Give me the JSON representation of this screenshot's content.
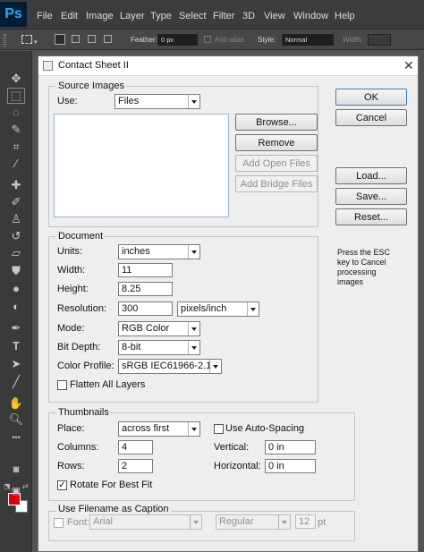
{
  "app": {
    "logo": "Ps"
  },
  "menubar": {
    "items": [
      "File",
      "Edit",
      "Image",
      "Layer",
      "Type",
      "Select",
      "Filter",
      "3D",
      "View",
      "Window",
      "Help"
    ]
  },
  "options_bar": {
    "feather_label": "Feather:",
    "feather_value": "0 px",
    "antialias_label": "Anti-alias",
    "style_label": "Style:",
    "style_value": "Normal",
    "width_label": "Width:"
  },
  "toolbar": {
    "tools": [
      "move-tool",
      "marquee-tool",
      "lasso-tool",
      "quick-select-tool",
      "crop-tool",
      "eyedropper-tool",
      "healing-brush-tool",
      "brush-tool",
      "clone-stamp-tool",
      "history-brush-tool",
      "eraser-tool",
      "paint-bucket-tool",
      "blur-tool",
      "dodge-tool",
      "pen-tool",
      "type-tool",
      "path-select-tool",
      "line-tool",
      "hand-tool",
      "zoom-tool"
    ],
    "foreground_color": "#e00000",
    "background_color": "#ffffff"
  },
  "dialog": {
    "title": "Contact Sheet II",
    "source_images": {
      "legend": "Source Images",
      "use_label": "Use:",
      "use_value": "Files",
      "buttons": [
        "Browse...",
        "Remove",
        "Add Open Files",
        "Add Bridge Files"
      ]
    },
    "document": {
      "legend": "Document",
      "units_label": "Units:",
      "units_value": "inches",
      "width_label": "Width:",
      "width_value": "11",
      "height_label": "Height:",
      "height_value": "8.25",
      "resolution_label": "Resolution:",
      "resolution_value": "300",
      "resolution_unit": "pixels/inch",
      "mode_label": "Mode:",
      "mode_value": "RGB Color",
      "bitdepth_label": "Bit Depth:",
      "bitdepth_value": "8-bit",
      "profile_label": "Color Profile:",
      "profile_value": "sRGB IEC61966-2.1",
      "flatten_label": "Flatten All Layers",
      "flatten_checked": false
    },
    "thumbnails": {
      "legend": "Thumbnails",
      "place_label": "Place:",
      "place_value": "across first",
      "autospacing_label": "Use Auto-Spacing",
      "autospacing_checked": false,
      "columns_label": "Columns:",
      "columns_value": "4",
      "rows_label": "Rows:",
      "rows_value": "2",
      "vertical_label": "Vertical:",
      "vertical_value": "0 in",
      "horizontal_label": "Horizontal:",
      "horizontal_value": "0 in",
      "rotate_label": "Rotate For Best Fit",
      "rotate_checked": true,
      "rotate_mark": "✓"
    },
    "caption": {
      "legend": "Use Filename as Caption",
      "font_label": "Font:",
      "font_value": "Arial",
      "style_value": "Regular",
      "size_value": "12",
      "size_unit": "pt"
    },
    "side_buttons": {
      "ok": "OK",
      "cancel": "Cancel",
      "load": "Load...",
      "save": "Save...",
      "reset": "Reset..."
    },
    "hint": "Press the ESC key to Cancel processing images"
  }
}
